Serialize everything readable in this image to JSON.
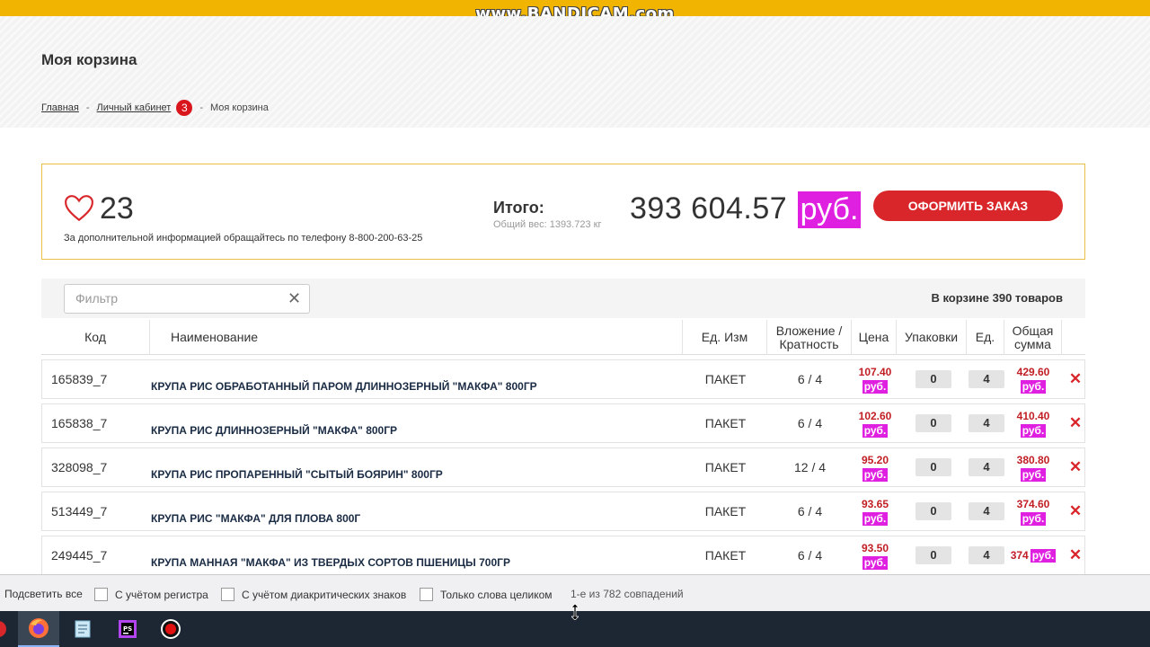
{
  "recorder": {
    "watermark": "www.BANDICAM.com"
  },
  "page": {
    "title": "Моя корзина",
    "breadcrumb": {
      "home": "Главная",
      "cabinet": "Личный кабинет",
      "cabinet_badge": "3",
      "current": "Моя корзина",
      "separator": "-"
    }
  },
  "summary": {
    "favorites_count": "23",
    "contact_text": "За дополнительной информацией обращайтесь по телефону 8-800-200-63-25",
    "total_label": "Итого:",
    "weight": "Общий вес: 1393.723 кг",
    "total_amount": "393 604.57",
    "currency": "руб.",
    "checkout_label": "ОФОРМИТЬ ЗАКАЗ"
  },
  "filter": {
    "placeholder": "Фильтр",
    "clear_icon": "✕",
    "cart_count_text": "В корзине 390 товаров"
  },
  "table": {
    "headers": {
      "code": "Код",
      "name": "Наименование",
      "unit": "Ед. Изм",
      "pack": "Вложение /Кратность",
      "price": "Цена",
      "packages": "Упаковки",
      "units": "Ед.",
      "total": "Общая сумма"
    },
    "rows": [
      {
        "code": "165839_7",
        "name": "КРУПА РИС ОБРАБОТАННЫЙ ПАРОМ ДЛИННОЗЕРНЫЙ \"МАКФА\" 800ГР",
        "unit": "ПАКЕТ",
        "pack": "6 / 4",
        "price": "107.40",
        "currency": "руб.",
        "packages": "0",
        "units": "4",
        "total": "429.60"
      },
      {
        "code": "165838_7",
        "name": "КРУПА РИС ДЛИННОЗЕРНЫЙ \"МАКФА\" 800ГР",
        "unit": "ПАКЕТ",
        "pack": "6 / 4",
        "price": "102.60",
        "currency": "руб.",
        "packages": "0",
        "units": "4",
        "total": "410.40"
      },
      {
        "code": "328098_7",
        "name": "КРУПА РИС ПРОПАРЕННЫЙ \"СЫТЫЙ БОЯРИН\" 800ГР",
        "unit": "ПАКЕТ",
        "pack": "12 / 4",
        "price": "95.20",
        "currency": "руб.",
        "packages": "0",
        "units": "4",
        "total": "380.80"
      },
      {
        "code": "513449_7",
        "name": "КРУПА РИС \"МАКФА\" ДЛЯ ПЛОВА 800Г",
        "unit": "ПАКЕТ",
        "pack": "6 / 4",
        "price": "93.65",
        "currency": "руб.",
        "packages": "0",
        "units": "4",
        "total": "374.60"
      },
      {
        "code": "249445_7",
        "name": "КРУПА МАННАЯ \"МАКФА\" ИЗ ТВЕРДЫХ СОРТОВ ПШЕНИЦЫ 700ГР",
        "unit": "ПАКЕТ",
        "pack": "6 / 4",
        "price": "93.50",
        "currency": "руб.",
        "packages": "0",
        "units": "4",
        "total": "374"
      }
    ],
    "delete_icon": "✕"
  },
  "findbar": {
    "highlight_all": "Подсветить все",
    "match_case": "С учётом регистра",
    "match_diacritics": "С учётом диакритических знаков",
    "whole_words": "Только слова целиком",
    "matches": "1-е из 782 совпадений"
  },
  "taskbar": {
    "apps": [
      "firefox-icon",
      "notepad-icon",
      "phpstorm-icon",
      "bandicam-record-icon"
    ]
  },
  "colors": {
    "accent_red": "#d9262b",
    "currency_magenta": "#e020e0",
    "topbar_yellow": "#f1b400",
    "summary_border": "#e8c04a"
  }
}
